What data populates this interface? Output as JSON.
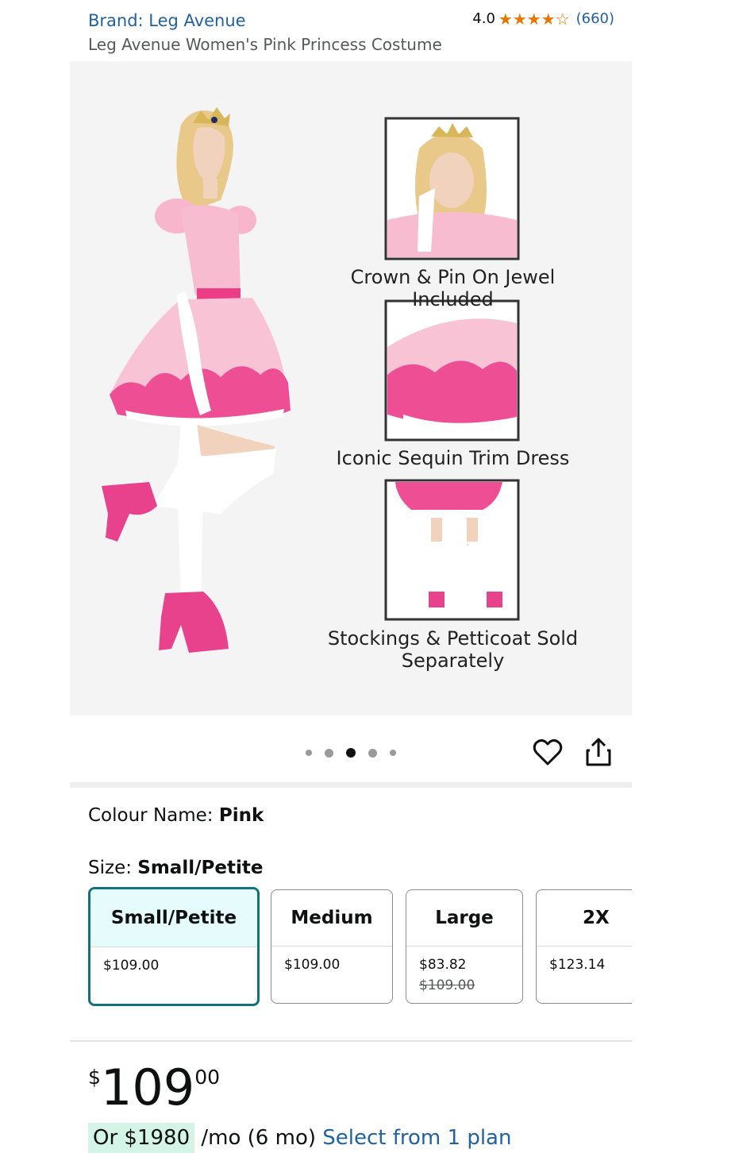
{
  "header": {
    "brand": "Brand: Leg Avenue",
    "title": "Leg Avenue Women's Pink Princess Costume",
    "rating_value": "4.0",
    "rating_stars": 4,
    "rating_count": "(660)"
  },
  "hero": {
    "captions": [
      "Crown & Pin On Jewel Included",
      "Iconic Sequin Trim Dress",
      "Stockings & Petticoat Sold Separately"
    ],
    "dots_total": 5,
    "active_dot": 3
  },
  "colour": {
    "label": "Colour Name: ",
    "value": "Pink"
  },
  "size": {
    "label": "Size: ",
    "value": "Small/Petite",
    "options": [
      {
        "name": "Small/Petite",
        "price": "$109.00",
        "was": ""
      },
      {
        "name": "Medium",
        "price": "$109.00",
        "was": ""
      },
      {
        "name": "Large",
        "price": "$83.82",
        "was": "$109.00"
      },
      {
        "name": "2X",
        "price": "$123.14",
        "was": ""
      }
    ]
  },
  "price": {
    "currency": "$",
    "whole": "109",
    "fraction": "00"
  },
  "monthly": {
    "amount": "Or $1980",
    "per": " /mo (6 mo) ",
    "link": "Select from 1 plan"
  },
  "colors": {
    "link": "#2162a1",
    "star": "#e77600",
    "selected_border": "#12737a"
  }
}
